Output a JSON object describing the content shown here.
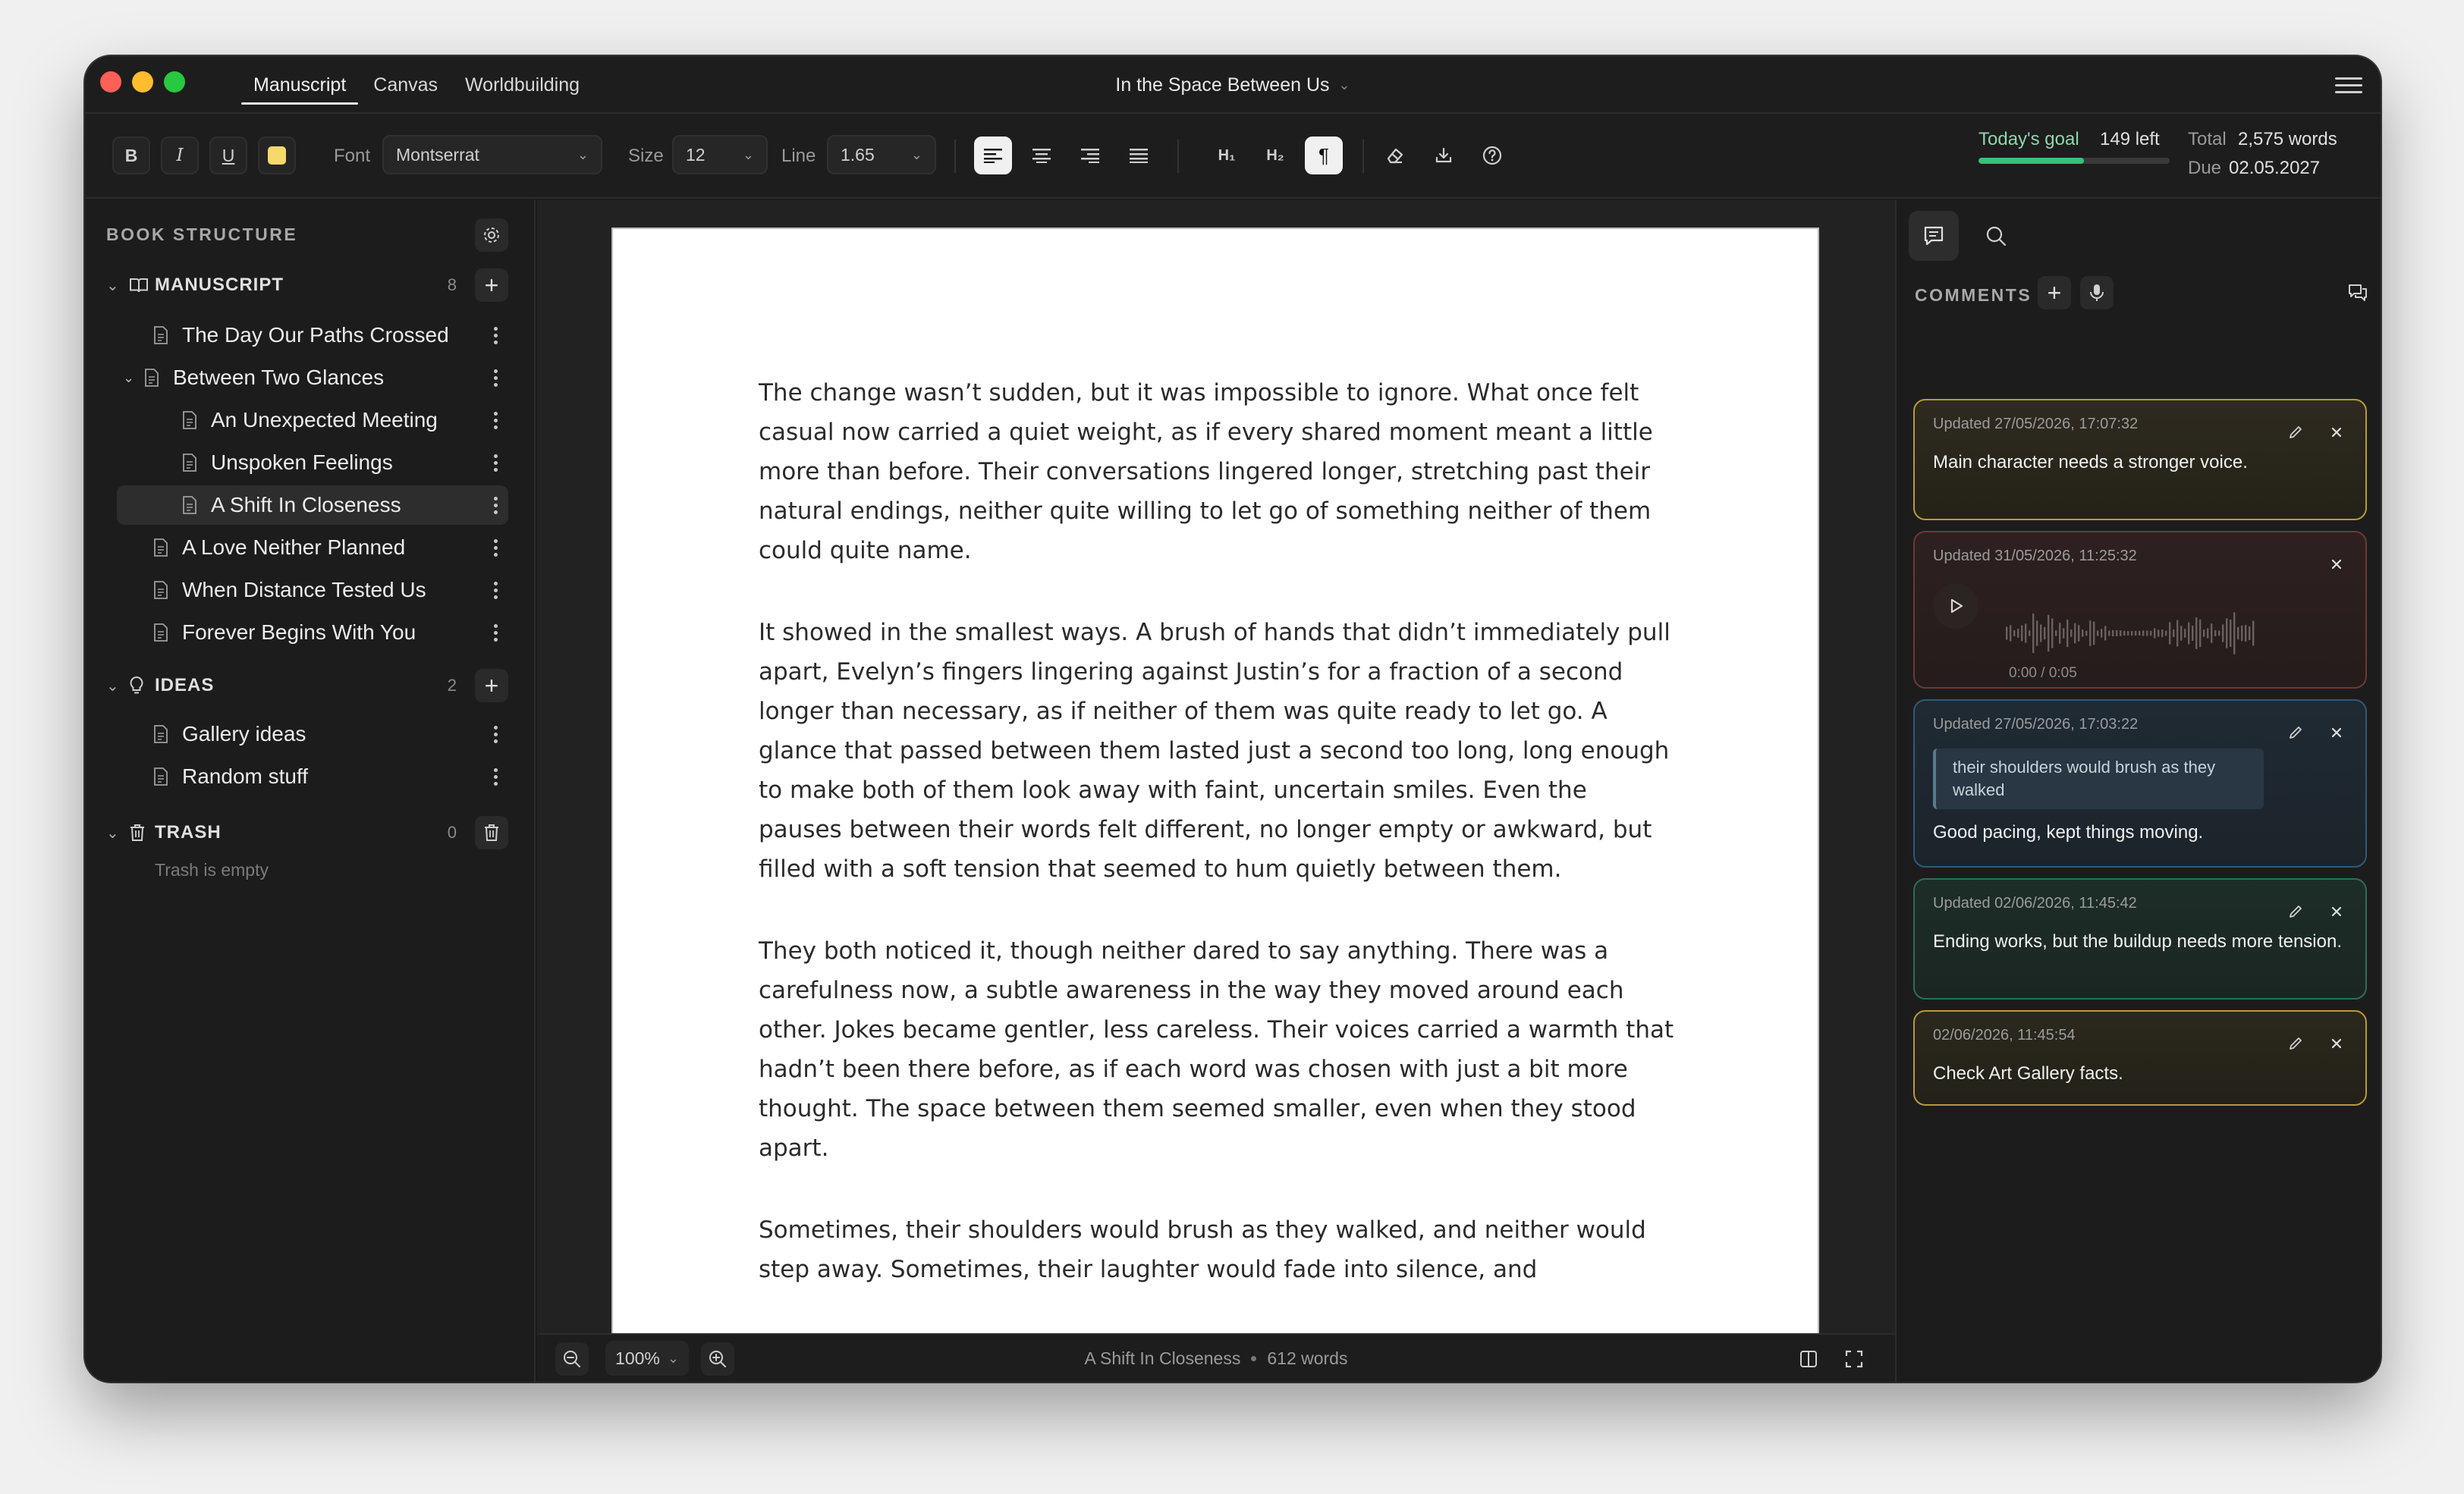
{
  "window": {
    "tabs": [
      "Manuscript",
      "Canvas",
      "Worldbuilding"
    ],
    "active_tab": "Manuscript",
    "doc_title": "In the Space Between Us"
  },
  "toolbar": {
    "bold": "B",
    "italic": "I",
    "underline": "U",
    "font_label": "Font",
    "font_value": "Montserrat",
    "size_label": "Size",
    "size_value": "12",
    "line_label": "Line",
    "line_value": "1.65",
    "h1": "H₁",
    "h2": "H₂",
    "pilcrow": "¶",
    "highlight_color": "#f6d86b"
  },
  "goal": {
    "label": "Today's goal",
    "left": "149 left",
    "progress": 0.55,
    "total_label": "Total",
    "total": "2,575 words",
    "due_label": "Due",
    "due": "02.05.2027"
  },
  "sidebar": {
    "heading": "BOOK STRUCTURE",
    "manuscript": {
      "label": "MANUSCRIPT",
      "count": "8",
      "items": [
        {
          "label": "The Day Our Paths Crossed"
        },
        {
          "label": "Between Two Glances"
        },
        {
          "label": "An Unexpected Meeting"
        },
        {
          "label": "Unspoken Feelings"
        },
        {
          "label": "A Shift In Closeness"
        },
        {
          "label": "A Love Neither Planned"
        },
        {
          "label": "When Distance Tested Us"
        },
        {
          "label": "Forever Begins With You"
        }
      ]
    },
    "ideas": {
      "label": "IDEAS",
      "count": "2",
      "items": [
        {
          "label": "Gallery ideas"
        },
        {
          "label": "Random stuff"
        }
      ]
    },
    "trash": {
      "label": "TRASH",
      "count": "0",
      "empty_text": "Trash is empty"
    }
  },
  "editor": {
    "paragraphs": [
      "The change wasn’t sudden, but it was impossible to ignore. What once felt casual now carried a quiet weight, as if every shared moment meant a little more than before. Their conversations lingered longer, stretching past their natural endings, neither quite willing to let go of something neither of them could quite name.",
      "It showed in the smallest ways. A brush of hands that didn’t immediately pull apart, Evelyn’s fingers lingering against Justin’s for a fraction of a second longer than necessary, as if neither of them was quite ready to let go. A glance that passed between them lasted just a second too long, long enough to make both of them look away with faint, uncertain smiles. Even the pauses between their words felt different, no longer empty or awkward, but filled with a soft tension that seemed to hum quietly between them.",
      "They both noticed it, though neither dared to say anything. There was a carefulness now, a subtle awareness in the way they moved around each other. Jokes became gentler, less careless. Their voices carried a warmth that hadn’t been there before, as if each word was chosen with just a bit more thought. The space between them seemed smaller, even when they stood apart.",
      "Sometimes, their shoulders would brush as they walked, and neither would step away. Sometimes, their laughter would fade into silence, and"
    ],
    "zoom": "100%",
    "chapter": "A Shift In Closeness",
    "word_count": "612 words"
  },
  "comments": {
    "heading": "COMMENTS",
    "items": [
      {
        "date": "Updated 27/05/2026, 17:07:32",
        "text": "Main character needs a stronger voice.",
        "color": "#b99a3a"
      },
      {
        "date": "Updated 31/05/2026, 11:25:32",
        "audio_time": "0:00 / 0:05",
        "color": "#6d3838"
      },
      {
        "date": "Updated 27/05/2026, 17:03:22",
        "quote": "their shoulders would brush as they walked",
        "text": "Good pacing, kept things moving.",
        "color": "#2f5a78"
      },
      {
        "date": "Updated 02/06/2026, 11:45:42",
        "text": "Ending works, but the buildup needs more tension.",
        "color": "#2c6e58"
      },
      {
        "date": "02/06/2026, 11:45:54",
        "text": "Check Art Gallery facts.",
        "color": "#b99a3a"
      }
    ]
  }
}
